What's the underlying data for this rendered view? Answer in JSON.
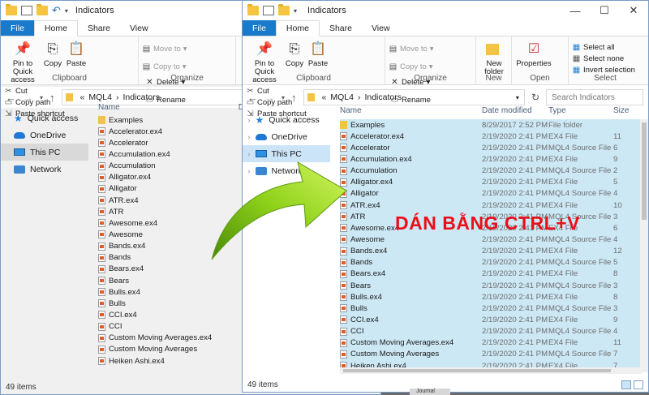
{
  "back_window": {
    "title": "Indicators",
    "tabs": [
      "File",
      "Home",
      "Share",
      "View"
    ],
    "clipboard": {
      "pin_label": "Pin to Quick access",
      "copy_label": "Copy",
      "paste_label": "Paste",
      "cut_label": "Cut",
      "copy_path_label": "Copy path",
      "paste_shortcut_label": "Paste shortcut",
      "group_label": "Clipboard"
    },
    "organize": {
      "move_to_label": "Move to",
      "copy_to_label": "Copy to",
      "delete_label": "Delete",
      "rename_label": "Rename",
      "group_label": "Organize"
    },
    "path": [
      "MQL4",
      "Indicators"
    ],
    "path_prefix": "«",
    "nav": [
      "Quick access",
      "OneDrive",
      "This PC",
      "Network"
    ],
    "name_header": "Name",
    "date_header": "D",
    "files": [
      "Examples",
      "Accelerator.ex4",
      "Accelerator",
      "Accumulation.ex4",
      "Accumulation",
      "Alligator.ex4",
      "Alligator",
      "ATR.ex4",
      "ATR",
      "Awesome.ex4",
      "Awesome",
      "Bands.ex4",
      "Bands",
      "Bears.ex4",
      "Bears",
      "Bulls.ex4",
      "Bulls",
      "CCI.ex4",
      "CCI",
      "Custom Moving Averages.ex4",
      "Custom Moving Averages",
      "Heiken Ashi.ex4"
    ],
    "status": "49 items"
  },
  "front_window": {
    "title": "Indicators",
    "tabs": [
      "File",
      "Home",
      "Share",
      "View"
    ],
    "clipboard": {
      "pin_label": "Pin to Quick access",
      "copy_label": "Copy",
      "paste_label": "Paste",
      "cut_label": "Cut",
      "copy_path_label": "Copy path",
      "paste_shortcut_label": "Paste shortcut",
      "group_label": "Clipboard"
    },
    "organize": {
      "move_to_label": "Move to",
      "copy_to_label": "Copy to",
      "delete_label": "Delete",
      "rename_label": "Rename",
      "group_label": "Organize"
    },
    "new": {
      "new_folder_label": "New folder",
      "group_label": "New"
    },
    "open": {
      "properties_label": "Properties",
      "group_label": "Open"
    },
    "select": {
      "select_all_label": "Select all",
      "select_none_label": "Select none",
      "invert_label": "Invert selection",
      "group_label": "Select"
    },
    "path": [
      "MQL4",
      "Indicators"
    ],
    "path_prefix": "«",
    "search_placeholder": "Search Indicators",
    "nav": [
      "Quick access",
      "OneDrive",
      "This PC",
      "Network"
    ],
    "headers": {
      "name": "Name",
      "date": "Date modified",
      "type": "Type",
      "size": "Size"
    },
    "files": [
      {
        "name": "Examples",
        "date": "8/29/2017 2:52 PM",
        "type": "File folder",
        "size": ""
      },
      {
        "name": "Accelerator.ex4",
        "date": "2/19/2020 2:41 PM",
        "type": "EX4 File",
        "size": "11"
      },
      {
        "name": "Accelerator",
        "date": "2/19/2020 2:41 PM",
        "type": "MQL4 Source File",
        "size": "6"
      },
      {
        "name": "Accumulation.ex4",
        "date": "2/19/2020 2:41 PM",
        "type": "EX4 File",
        "size": "9"
      },
      {
        "name": "Accumulation",
        "date": "2/19/2020 2:41 PM",
        "type": "MQL4 Source File",
        "size": "2"
      },
      {
        "name": "Alligator.ex4",
        "date": "2/19/2020 2:41 PM",
        "type": "EX4 File",
        "size": "5"
      },
      {
        "name": "Alligator",
        "date": "2/19/2020 2:41 PM",
        "type": "MQL4 Source File",
        "size": "4"
      },
      {
        "name": "ATR.ex4",
        "date": "2/19/2020 2:41 PM",
        "type": "EX4 File",
        "size": "10"
      },
      {
        "name": "ATR",
        "date": "2/19/2020 2:41 PM",
        "type": "MQL4 Source File",
        "size": "3"
      },
      {
        "name": "Awesome.ex4",
        "date": "2/19/2020 2:41 PM",
        "type": "EX4 File",
        "size": "6"
      },
      {
        "name": "Awesome",
        "date": "2/19/2020 2:41 PM",
        "type": "MQL4 Source File",
        "size": "4"
      },
      {
        "name": "Bands.ex4",
        "date": "2/19/2020 2:41 PM",
        "type": "EX4 File",
        "size": "12"
      },
      {
        "name": "Bands",
        "date": "2/19/2020 2:41 PM",
        "type": "MQL4 Source File",
        "size": "5"
      },
      {
        "name": "Bears.ex4",
        "date": "2/19/2020 2:41 PM",
        "type": "EX4 File",
        "size": "8"
      },
      {
        "name": "Bears",
        "date": "2/19/2020 2:41 PM",
        "type": "MQL4 Source File",
        "size": "3"
      },
      {
        "name": "Bulls.ex4",
        "date": "2/19/2020 2:41 PM",
        "type": "EX4 File",
        "size": "8"
      },
      {
        "name": "Bulls",
        "date": "2/19/2020 2:41 PM",
        "type": "MQL4 Source File",
        "size": "3"
      },
      {
        "name": "CCI.ex4",
        "date": "2/19/2020 2:41 PM",
        "type": "EX4 File",
        "size": "9"
      },
      {
        "name": "CCI",
        "date": "2/19/2020 2:41 PM",
        "type": "MQL4 Source File",
        "size": "4"
      },
      {
        "name": "Custom Moving Averages.ex4",
        "date": "2/19/2020 2:41 PM",
        "type": "EX4 File",
        "size": "11"
      },
      {
        "name": "Custom Moving Averages",
        "date": "2/19/2020 2:41 PM",
        "type": "MQL4 Source File",
        "size": "7"
      },
      {
        "name": "Heiken Ashi.ex4",
        "date": "2/19/2020 2:41 PM",
        "type": "EX4 File",
        "size": "7"
      }
    ],
    "status": "49 items"
  },
  "annotation": "DÁN BẰNG CTRL+V",
  "taskbar_journal": "Journal",
  "colors": {
    "selection": "#cce8f5",
    "accent": "#1979ca",
    "arrow": "#8ed11a",
    "annotation": "#e8101a"
  }
}
